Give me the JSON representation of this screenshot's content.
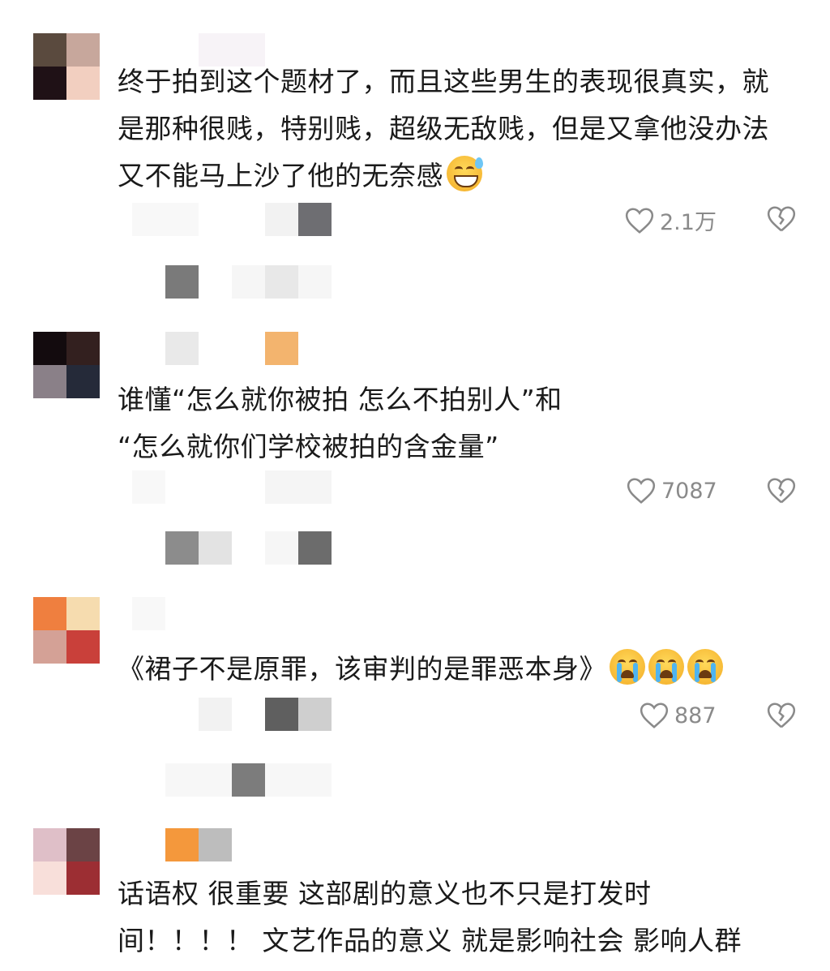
{
  "comments": [
    {
      "text_lines": [
        "终于拍到这个题材了，而且这些男生的表现很真实，就",
        "是那种很贱，特别贱，超级无敌贱，但是又拿他没办法",
        "又不能马上沙了他的无奈感"
      ],
      "emoji": "grinning-sweat-emoji",
      "likes": "2.1万",
      "avatar_colors": [
        "#5a4a3e",
        "#c7a79c",
        "#1f1116",
        "#f2cfc0"
      ]
    },
    {
      "text_lines": [
        "谁懂“怎么就你被拍 怎么不拍别人”和",
        "“怎么就你们学校被拍的含金量”"
      ],
      "likes": "7087",
      "avatar_colors": [
        "#130b0e",
        "#33201f",
        "#8a8088",
        "#252a39"
      ]
    },
    {
      "text_lines": [
        "《裙子不是原罪，该审判的是罪恶本身》"
      ],
      "emoji": "crying-face-emoji",
      "emoji_count": 3,
      "likes": "887",
      "avatar_colors": [
        "#ef7f3f",
        "#f6dcaf",
        "#d4a196",
        "#c9403a"
      ]
    },
    {
      "text_lines": [
        "话语权 很重要 这部剧的意义也不只是打发时",
        "间！！！！ 文艺作品的意义 就是影响社会 影响人群"
      ],
      "avatar_colors": [
        "#dfbfc8",
        "#6b4345",
        "#f8dfda",
        "#9c2e33"
      ]
    }
  ],
  "colors": {
    "meta_gray": "#8a8a8a",
    "text": "#1a1a1a",
    "background": "#ffffff"
  }
}
